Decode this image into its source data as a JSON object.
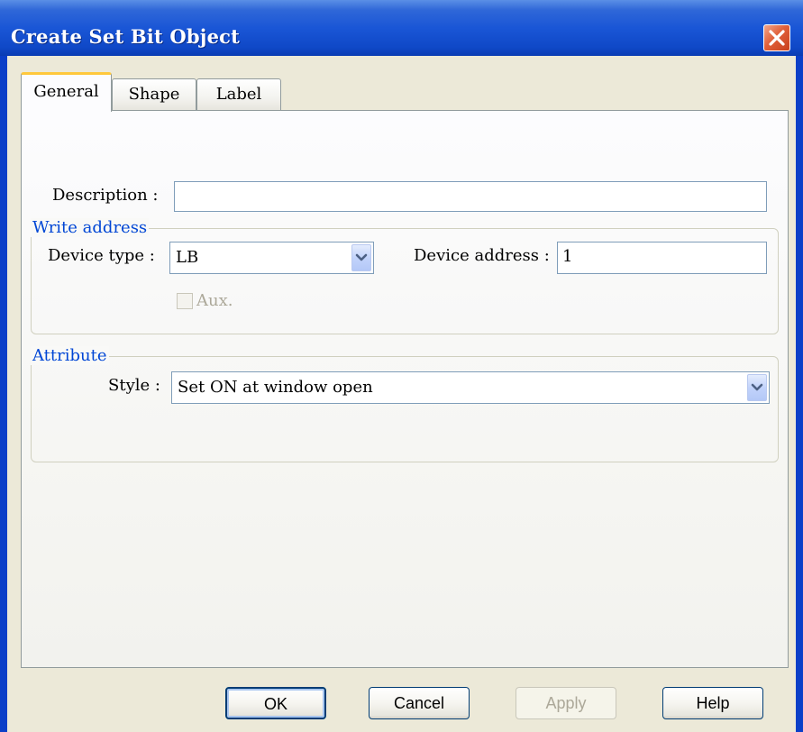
{
  "window": {
    "title": "Create Set Bit Object",
    "close_icon": "close-icon"
  },
  "tabs": [
    {
      "label": "General",
      "active": true
    },
    {
      "label": "Shape",
      "active": false
    },
    {
      "label": "Label",
      "active": false
    }
  ],
  "general": {
    "description_label": "Description :",
    "description_value": "",
    "write_address": {
      "title": "Write address",
      "device_type_label": "Device type :",
      "device_type_value": "LB",
      "device_address_label": "Device address :",
      "device_address_value": "1",
      "aux_label": "Aux.",
      "aux_checked": false,
      "aux_enabled": false
    },
    "attribute": {
      "title": "Attribute",
      "style_label": "Style :",
      "style_value": "Set ON at window open"
    }
  },
  "buttons": {
    "ok": "OK",
    "cancel": "Cancel",
    "apply": "Apply",
    "help": "Help"
  },
  "colors": {
    "titlebar": "#0b3fc8",
    "active_tab_accent": "#ffc83c",
    "group_title": "#0046d5",
    "dialog_face": "#ece9d8"
  }
}
